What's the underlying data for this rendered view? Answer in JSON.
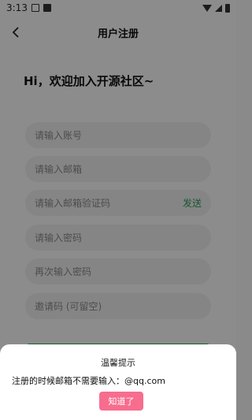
{
  "status_bar": {
    "time": "3:13"
  },
  "header": {
    "title": "用户注册"
  },
  "greeting": "Hi，欢迎加入开源社区~",
  "form": {
    "account_placeholder": "请输入账号",
    "email_placeholder": "请输入邮箱",
    "code_placeholder": "请输入邮箱验证码",
    "send_label": "发送",
    "password_placeholder": "请输入密码",
    "password_confirm_placeholder": "再次输入密码",
    "invite_placeholder": "邀请码 (可留空)"
  },
  "dialog": {
    "title": "温馨提示",
    "message": "注册的时候邮箱不需要输入：@qq.com",
    "button_label": "知道了"
  },
  "colors": {
    "accent_green": "#2e9e5b",
    "button_pink": "#f76d8e"
  }
}
